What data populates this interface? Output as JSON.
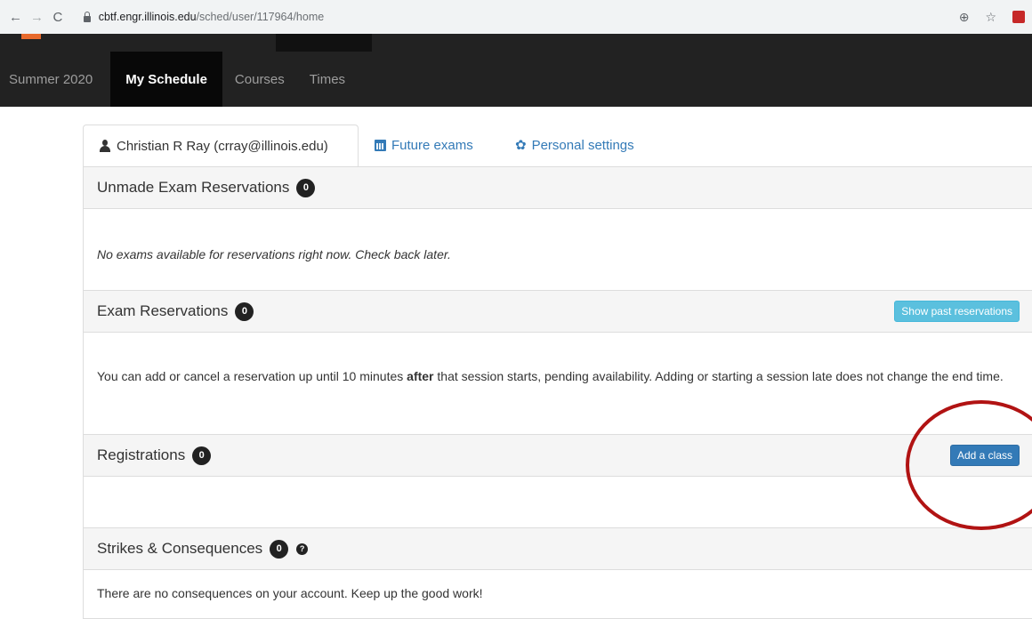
{
  "browser": {
    "back_icon": "←",
    "forward_icon": "→",
    "reload_icon": "C",
    "url_host": "cbtf.engr.illinois.edu",
    "url_path": "/sched/user/117964/home",
    "zoom_icon": "⊕",
    "star_icon": "☆"
  },
  "navbar": {
    "items": [
      {
        "label": "Summer 2020"
      },
      {
        "label": "My Schedule"
      },
      {
        "label": "Courses"
      },
      {
        "label": "Times"
      }
    ]
  },
  "tabs": {
    "profile": "Christian R Ray (crray@illinois.edu)",
    "future": "Future exams",
    "settings": "Personal settings"
  },
  "panels": {
    "unmade": {
      "title": "Unmade Exam Reservations",
      "count": "0",
      "message": "No exams available for reservations right now. Check back later."
    },
    "reservations": {
      "title": "Exam Reservations",
      "count": "0",
      "button": "Show past reservations",
      "message_before": "You can add or cancel a reservation up until 10 minutes ",
      "message_bold": "after",
      "message_after": " that session starts, pending availability. Adding or starting a session late does not change the end time."
    },
    "registrations": {
      "title": "Registrations",
      "count": "0",
      "button": "Add a class"
    },
    "strikes": {
      "title": "Strikes & Consequences",
      "count": "0",
      "help": "?",
      "message": "There are no consequences on your account. Keep up the good work!"
    }
  },
  "colors": {
    "navbar_bg": "#222222",
    "link": "#337ab7",
    "info_button": "#5bc0de",
    "primary_button": "#337ab7",
    "annotation": "#b11313"
  }
}
